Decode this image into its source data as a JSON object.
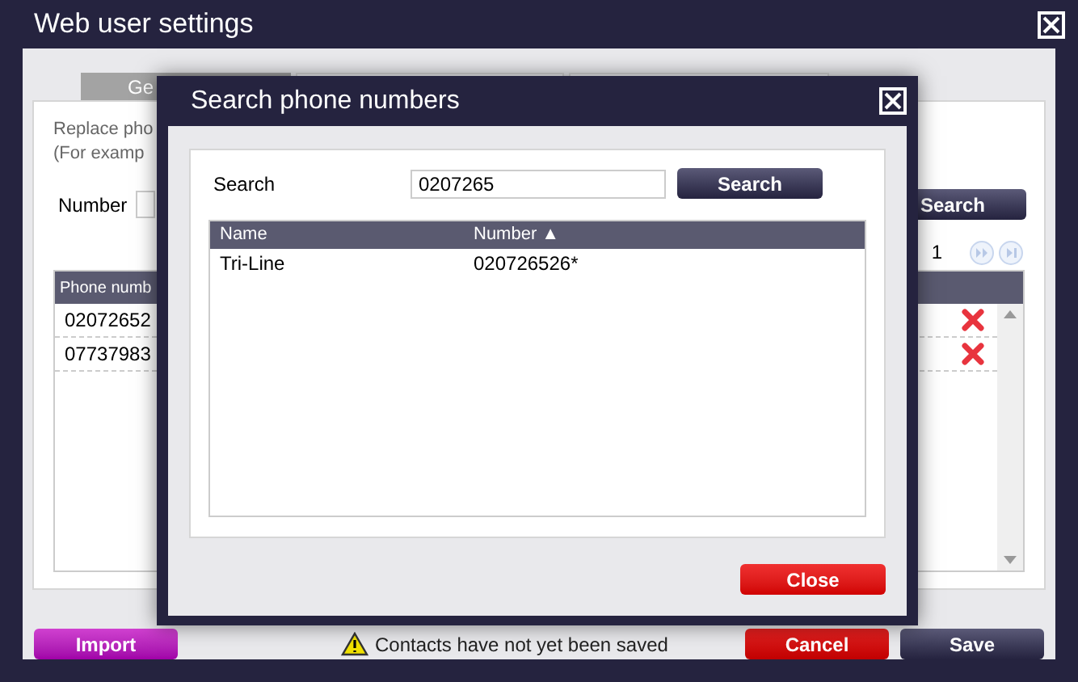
{
  "window": {
    "title": "Web user settings"
  },
  "tabs": [
    {
      "label": "Ge",
      "selected": true
    },
    {
      "selected": false
    },
    {
      "selected": false
    }
  ],
  "instructions": [
    "Replace pho",
    "(For examp"
  ],
  "number_filter": {
    "label": "Number"
  },
  "search_button": "Search",
  "pager": {
    "page": "1"
  },
  "phone_table": {
    "columns": [
      "Phone numb"
    ],
    "rows": [
      "02072652",
      "07737983"
    ]
  },
  "footer": {
    "import": "Import",
    "warning": "Contacts have not yet been saved",
    "cancel": "Cancel",
    "save": "Save"
  },
  "dialog": {
    "title": "Search phone numbers",
    "search_label": "Search",
    "search_value": "0207265",
    "search_button": "Search",
    "columns": [
      "Name",
      "Number ▲"
    ],
    "rows": [
      [
        "Tri-Line",
        "020726526*"
      ]
    ],
    "close_button": "Close"
  }
}
